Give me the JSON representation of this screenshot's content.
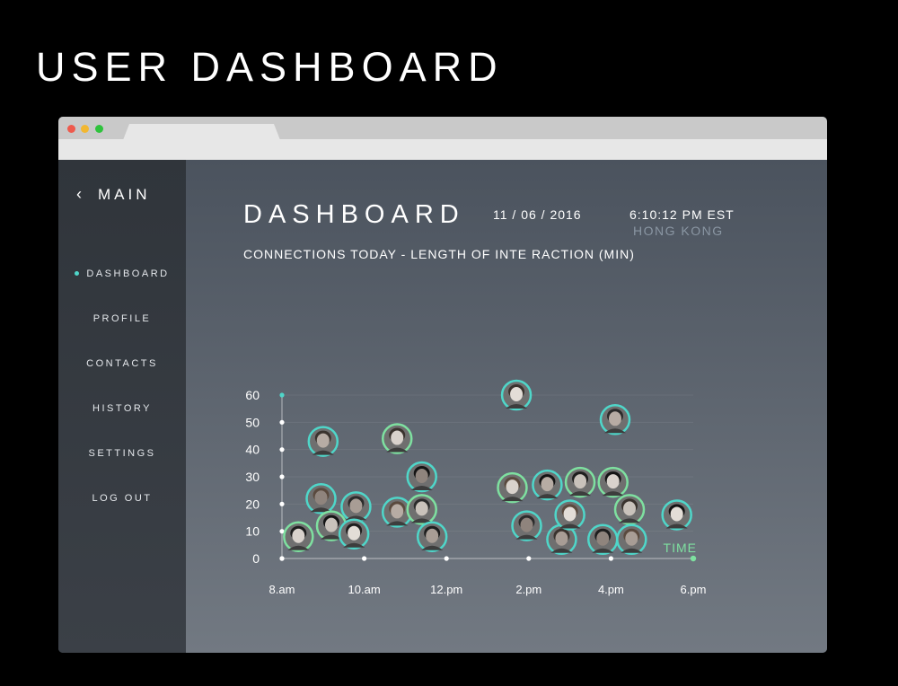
{
  "page": {
    "title": "USER DASHBOARD"
  },
  "sidebar": {
    "header": {
      "back_icon": "chevron-left-icon",
      "label": "MAIN"
    },
    "items": [
      {
        "label": "DASHBOARD",
        "active": true
      },
      {
        "label": "PROFILE",
        "active": false
      },
      {
        "label": "CONTACTS",
        "active": false
      },
      {
        "label": "HISTORY",
        "active": false
      },
      {
        "label": "SETTINGS",
        "active": false
      },
      {
        "label": "LOG OUT",
        "active": false
      }
    ]
  },
  "dashboard": {
    "title": "DASHBOARD",
    "date": "11 / 06 / 2016",
    "time": "6:10:12 PM EST",
    "city": "HONG KONG"
  },
  "colors": {
    "accent_teal": "#4fd6c9",
    "accent_green": "#7ee0a0",
    "sidebar_bg": "#30353b",
    "main_bg_top": "#4b535e"
  },
  "chart_data": {
    "type": "scatter",
    "title": "CONNECTIONS TODAY - LENGTH OF INTE RACTION (MIN)",
    "xlabel": "TIME",
    "ylabel": "",
    "x_ticks": [
      "8.am",
      "10.am",
      "12.pm",
      "2.pm",
      "4.pm",
      "6.pm"
    ],
    "y_ticks": [
      0,
      10,
      20,
      30,
      40,
      50,
      60
    ],
    "xlim": [
      8,
      18
    ],
    "ylim": [
      0,
      60
    ],
    "grid": true,
    "marker": "avatar-photo",
    "points": [
      {
        "x": 8.4,
        "y": 8
      },
      {
        "x": 9.0,
        "y": 43
      },
      {
        "x": 8.95,
        "y": 22
      },
      {
        "x": 9.2,
        "y": 12
      },
      {
        "x": 9.8,
        "y": 19
      },
      {
        "x": 9.75,
        "y": 9
      },
      {
        "x": 10.8,
        "y": 44
      },
      {
        "x": 10.8,
        "y": 17
      },
      {
        "x": 11.4,
        "y": 30
      },
      {
        "x": 11.4,
        "y": 18
      },
      {
        "x": 11.65,
        "y": 8
      },
      {
        "x": 13.7,
        "y": 60
      },
      {
        "x": 13.6,
        "y": 26
      },
      {
        "x": 14.45,
        "y": 27
      },
      {
        "x": 13.95,
        "y": 12
      },
      {
        "x": 15.25,
        "y": 28
      },
      {
        "x": 14.8,
        "y": 7
      },
      {
        "x": 15.0,
        "y": 16
      },
      {
        "x": 16.05,
        "y": 28
      },
      {
        "x": 16.1,
        "y": 51
      },
      {
        "x": 15.8,
        "y": 7
      },
      {
        "x": 16.45,
        "y": 18
      },
      {
        "x": 16.5,
        "y": 7
      },
      {
        "x": 17.6,
        "y": 16
      }
    ]
  }
}
